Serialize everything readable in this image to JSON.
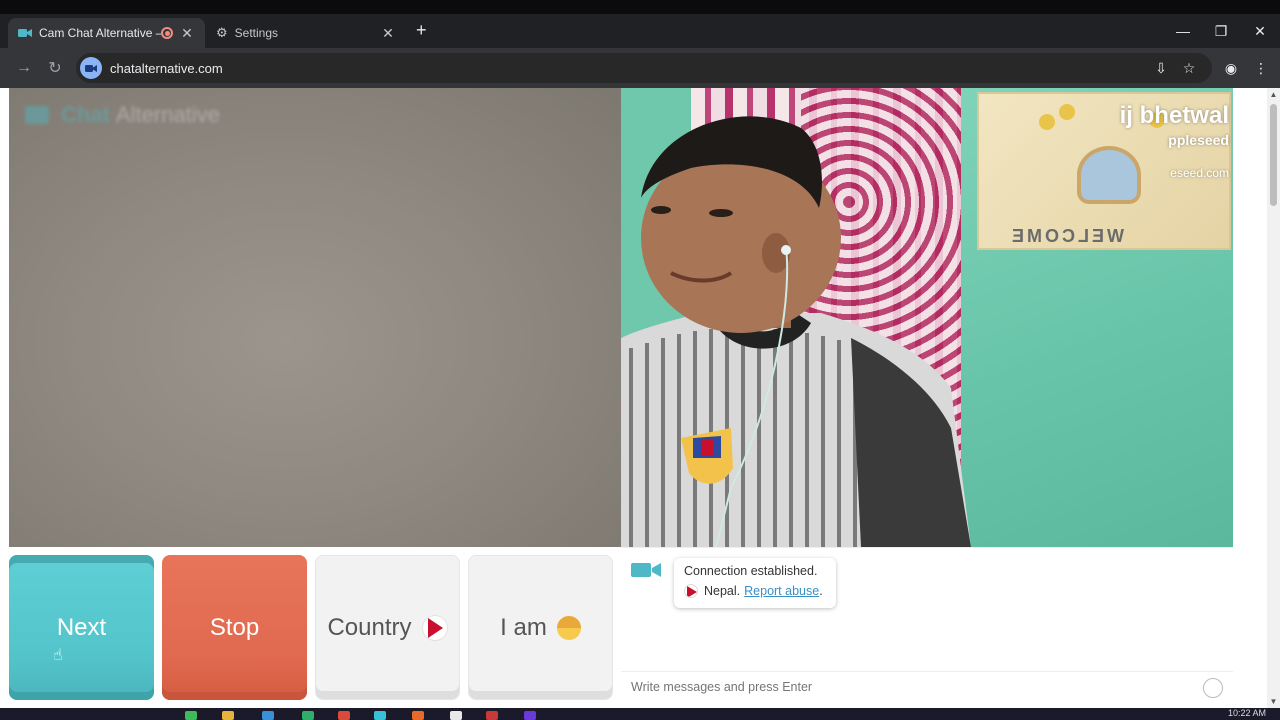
{
  "browser": {
    "tabs": [
      {
        "title": "Cam Chat Alternative – Free",
        "active": true,
        "recording": true
      },
      {
        "title": "Settings",
        "active": false
      }
    ],
    "url": "chatalternative.com"
  },
  "site": {
    "logo_text": "Chat",
    "logo_text2": "Alternative"
  },
  "remote_video": {
    "overlay_name": "ij bhetwal",
    "overlay_sub": "ppleseed",
    "overlay_url": "eseed.com",
    "poster_text": "WELCOME"
  },
  "buttons": {
    "next": "Next",
    "stop": "Stop",
    "country": "Country",
    "iam": "I am"
  },
  "chat": {
    "status": "Connection established.",
    "country": "Nepal.",
    "report": "Report abuse",
    "report_suffix": ".",
    "input_placeholder": "Write messages and press Enter"
  },
  "system": {
    "time": "10:22 AM"
  },
  "colors": {
    "next": "#54c4cb",
    "stop": "#e06a4f",
    "neutral": "#f2f2f2",
    "link": "#3a8fc4"
  },
  "icons": [
    "video-camera-icon",
    "gear-icon",
    "close-icon",
    "plus-icon",
    "forward-icon",
    "reload-icon",
    "install-icon",
    "star-icon",
    "profile-icon",
    "menu-icon",
    "nepal-flag-icon",
    "face-emoji-icon",
    "smile-icon"
  ]
}
